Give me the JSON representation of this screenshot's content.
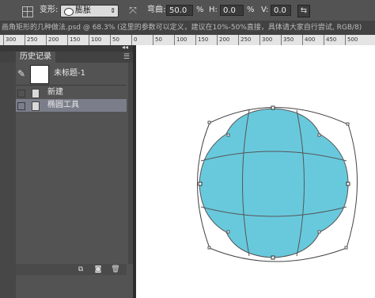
{
  "options": {
    "warp_label": "变形:",
    "warp_style": "膨胀",
    "bend_label": "弯曲:",
    "bend_value": "50.0",
    "h_label": "H:",
    "h_value": "0.0",
    "v_label": "V:",
    "v_value": "0.0",
    "percent": "%"
  },
  "document_tab": {
    "title": "画角矩形的几种做法.psd @ 68.3% (这里的参数可以定义，建议在10%-50%直接，具体请大家自行尝试, RGB/8)"
  },
  "ruler": {
    "ticks": [
      "300",
      "250",
      "200",
      "150",
      "100",
      "50",
      "0",
      "50",
      "100",
      "150",
      "200",
      "250",
      "300",
      "350",
      "400",
      "450",
      "500"
    ]
  },
  "history_panel": {
    "tab_label": "历史记录",
    "snapshot_label": "未标题-1",
    "items": [
      {
        "label": "新建",
        "selected": false
      },
      {
        "label": "椭圆工具",
        "selected": true
      }
    ]
  },
  "canvas": {
    "shape_fill": "#68c9dd",
    "shape_stroke": "#555555"
  },
  "icons": [
    "grid-tool-icon",
    "warp-shape-icon",
    "warp-orientation-icon",
    "toggle-warp-icon",
    "brush-source-icon",
    "new-document-icon",
    "snapshot-camera-icon",
    "trash-icon",
    "panel-menu-icon"
  ]
}
